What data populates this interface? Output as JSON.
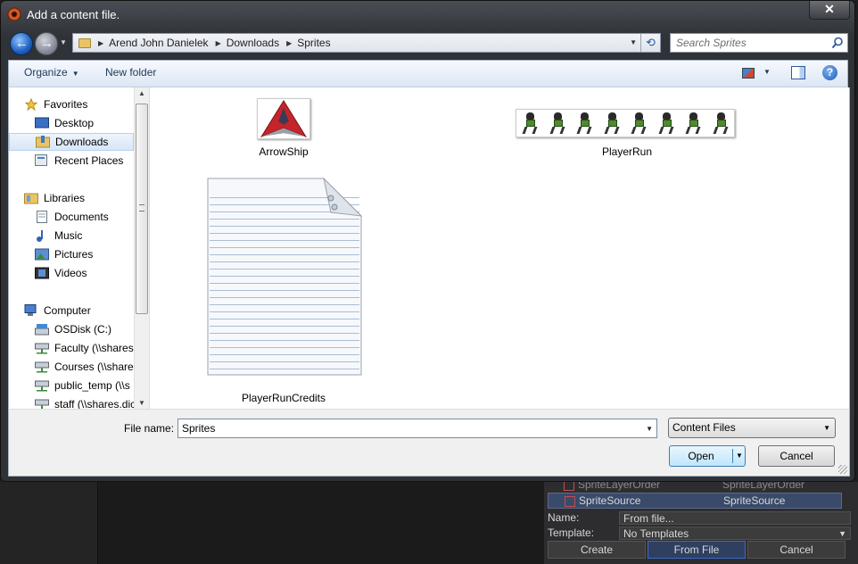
{
  "window": {
    "title": "Add a content file.",
    "close_glyph": "✕"
  },
  "address": {
    "crumbs": [
      "Arend John Danielek",
      "Downloads",
      "Sprites"
    ]
  },
  "search": {
    "placeholder": "Search Sprites"
  },
  "toolbar": {
    "organize_label": "Organize",
    "new_folder_label": "New folder",
    "help_glyph": "?"
  },
  "nav": {
    "items": [
      {
        "label": "Favorites",
        "icon": "star-icon",
        "level": 0
      },
      {
        "label": "Desktop",
        "icon": "desktop-icon",
        "level": 1
      },
      {
        "label": "Downloads",
        "icon": "downloads-folder-icon",
        "level": 1,
        "selected": true
      },
      {
        "label": "Recent Places",
        "icon": "recent-places-icon",
        "level": 1
      },
      {
        "label": "Libraries",
        "icon": "libraries-icon",
        "level": 0
      },
      {
        "label": "Documents",
        "icon": "documents-icon",
        "level": 1
      },
      {
        "label": "Music",
        "icon": "music-icon",
        "level": 1
      },
      {
        "label": "Pictures",
        "icon": "pictures-icon",
        "level": 1
      },
      {
        "label": "Videos",
        "icon": "videos-icon",
        "level": 1
      },
      {
        "label": "Computer",
        "icon": "computer-icon",
        "level": 0
      },
      {
        "label": "OSDisk (C:)",
        "icon": "drive-icon",
        "level": 1
      },
      {
        "label": "Faculty (\\\\shares",
        "icon": "network-drive-icon",
        "level": 1
      },
      {
        "label": "Courses (\\\\shares",
        "icon": "network-drive-icon",
        "level": 1
      },
      {
        "label": "public_temp (\\\\s",
        "icon": "network-drive-icon",
        "level": 1
      },
      {
        "label": "staff (\\\\shares.dic",
        "icon": "network-drive-icon",
        "level": 1
      }
    ]
  },
  "files": [
    {
      "name": "ArrowShip",
      "icon": "arrowship-thumbnail"
    },
    {
      "name": "PlayerRun",
      "icon": "playerrun-thumbnail"
    },
    {
      "name": "PlayerRunCredits",
      "icon": "text-document-thumbnail"
    }
  ],
  "bottom": {
    "file_name_label": "File name:",
    "file_name_value": "Sprites",
    "file_type_selected": "Content Files",
    "open_label": "Open",
    "cancel_label": "Cancel"
  },
  "background_panel": {
    "row1": {
      "name": "SpriteLayerOrder",
      "type": "SpriteLayerOrder"
    },
    "row2": {
      "name": "SpriteSource",
      "type": "SpriteSource"
    },
    "name_label": "Name:",
    "name_value": "From file...",
    "template_label": "Template:",
    "template_value": "No Templates",
    "create_label": "Create",
    "from_file_label": "From File",
    "cancel_label": "Cancel"
  },
  "colors": {
    "accent": "#3c7fb1",
    "titlebar": "#2f3237",
    "selection": "#d7e6f8"
  }
}
